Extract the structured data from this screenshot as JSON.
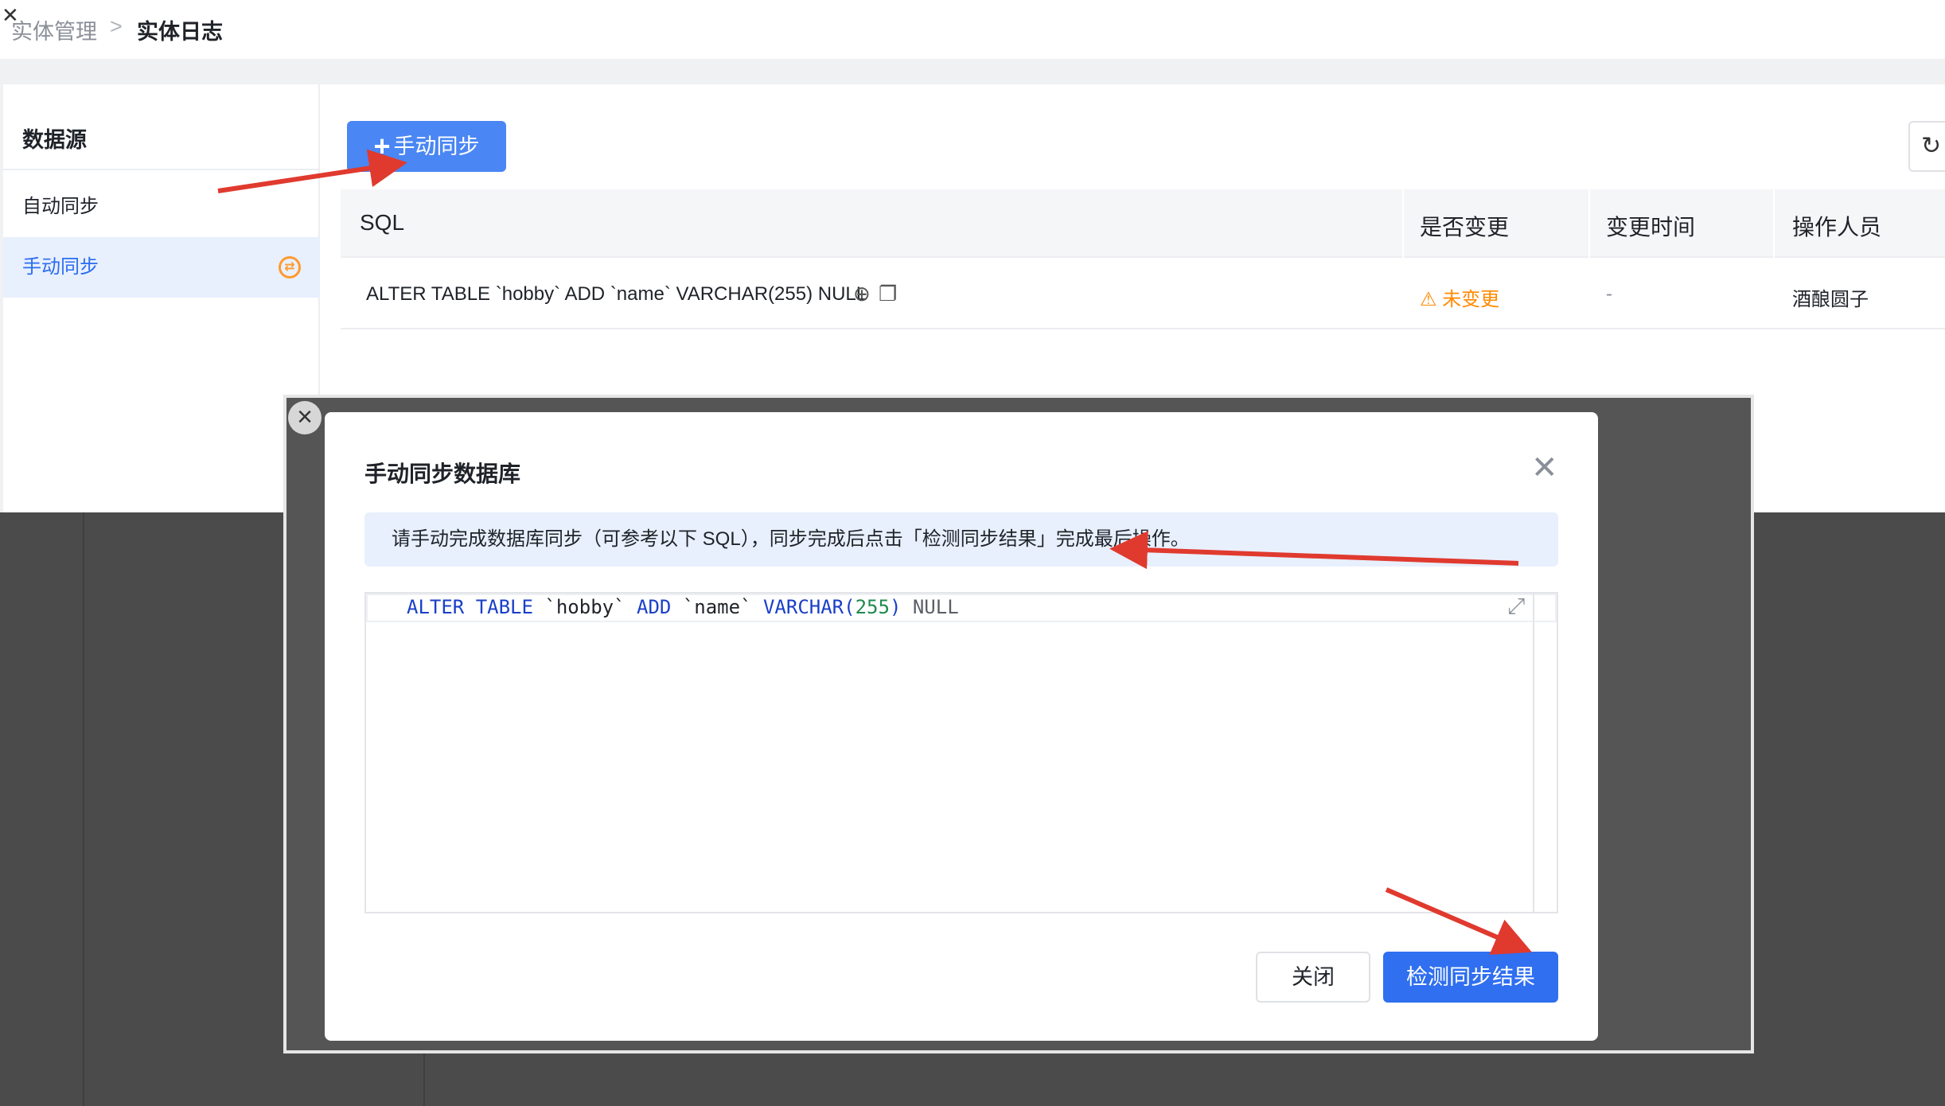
{
  "breadcrumb": {
    "parent": "实体管理",
    "separator": ">",
    "current": "实体日志"
  },
  "sidebar": {
    "title": "数据源",
    "items": [
      {
        "label": "自动同步"
      },
      {
        "label": "手动同步"
      }
    ]
  },
  "toolbar": {
    "manual_sync_label": "手动同步"
  },
  "table": {
    "headers": [
      "SQL",
      "是否变更",
      "变更时间",
      "操作人员"
    ],
    "rows": [
      {
        "sql": "ALTER TABLE `hobby` ADD `name` VARCHAR(255) NULL",
        "changed": "未变更",
        "time": "-",
        "operator": "酒酿圆子"
      }
    ]
  },
  "background_ghost": {
    "header": "变更",
    "header2": "变",
    "status": "变更",
    "dash": "-"
  },
  "modal": {
    "title": "手动同步数据库",
    "alert": "请手动完成数据库同步（可参考以下 SQL），同步完成后点击「检测同步结果」完成最后操作。",
    "code": {
      "kw_alter": "ALTER",
      "kw_table": "TABLE",
      "ident_table": "`hobby`",
      "kw_add": "ADD",
      "ident_col": "`name`",
      "kw_type": "VARCHAR",
      "paren_open": "(",
      "num": "255",
      "paren_close": ")",
      "kw_null": "NULL"
    },
    "close_label": "关闭",
    "check_label": "检测同步结果"
  },
  "colors": {
    "primary": "#2f6ff0",
    "warning": "#ff8a00",
    "annotation_arrow": "#e03a2f"
  }
}
